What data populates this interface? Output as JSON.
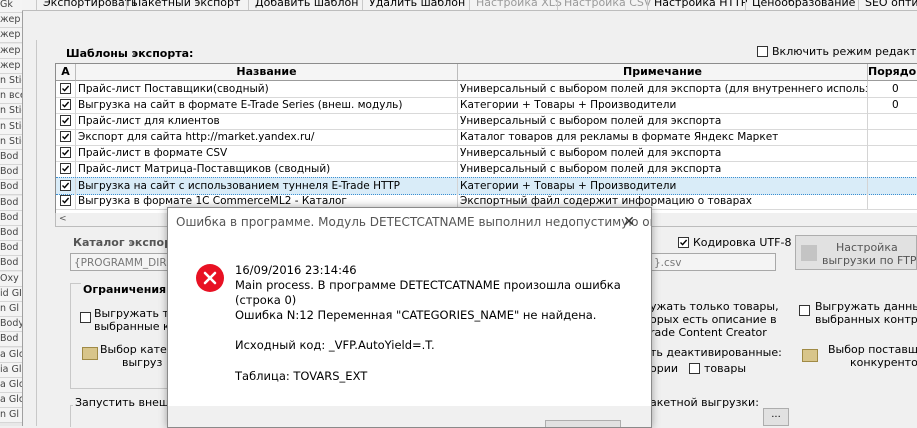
{
  "left_strip": {
    "items": [
      "Gk",
      "жер I",
      "жер I",
      "жер I",
      "жер I",
      "n Stig",
      "n все",
      "n Stig",
      "n Stig",
      "n Stig",
      "Bod",
      "Bod",
      "Bod",
      "Bod",
      "Bod",
      "Bod",
      "Bod",
      "Bod",
      "Oxy",
      "id GI",
      "n Gl",
      "Body",
      "Bod",
      "a Glo",
      "ia Gl",
      "a Glo",
      "a Glo",
      "n Gl"
    ]
  },
  "toolbar": {
    "items": [
      {
        "label": "Экспортировать",
        "disabled": false
      },
      {
        "label": "Пакетный экспорт",
        "disabled": false
      },
      {
        "label": "Добавить шаблон",
        "disabled": false
      },
      {
        "label": "Удалить шаблон",
        "disabled": false
      },
      {
        "label": "Настройка XLS",
        "disabled": true
      },
      {
        "label": "Настройка CSV",
        "disabled": true
      },
      {
        "label": "Настройка HTTP",
        "disabled": false
      },
      {
        "label": "Ценообразование",
        "disabled": false
      },
      {
        "label": "SEO оптими",
        "disabled": false
      }
    ]
  },
  "templates": {
    "title": "Шаблоны экспорта:",
    "editor_mode_label": "Включить режим редактиро",
    "columns": {
      "active": "А",
      "name": "Название",
      "note": "Примечание",
      "order": "Порядо"
    },
    "rows": [
      {
        "checked": true,
        "name": "Прайс-лист Поставщики(сводный)",
        "note": "Универсальный с выбором полей для экспорта (для внутреннего использования",
        "order": "0",
        "selected": false
      },
      {
        "checked": true,
        "name": "Выгрузка на сайт в формате E-Trade Series (внеш. модуль)",
        "note": "Категории + Товары + Производители",
        "order": "0",
        "selected": false
      },
      {
        "checked": true,
        "name": "Прайс-лист для клиентов",
        "note": "Универсальный с выбором полей для экспорта",
        "order": "",
        "selected": false
      },
      {
        "checked": true,
        "name": "Экспорт для сайта http://market.yandex.ru/",
        "note": "Каталог товаров для рекламы в формате Яндекс Маркет",
        "order": "",
        "selected": false
      },
      {
        "checked": true,
        "name": "Прайс-лист в формате CSV",
        "note": "Универсальный с выбором полей для экспорта",
        "order": "",
        "selected": false
      },
      {
        "checked": true,
        "name": "Прайс-лист Матрица-Поставщиков (сводный)",
        "note": "Универсальный с выбором полей для экспорта",
        "order": "",
        "selected": false
      },
      {
        "checked": true,
        "name": "Выгрузка на сайт с использованием туннеля E-Trade HTTP",
        "note": "Категории + Товары + Производители",
        "order": "",
        "selected": true
      },
      {
        "checked": true,
        "name": "Выгрузка в формате  1С CommerceML2 - Каталог",
        "note": "Экспортный файл содержит информацию о товарах",
        "order": "",
        "selected": false
      }
    ]
  },
  "export_settings": {
    "catalog_label": "Каталог экспорт",
    "catalog_value": "{PROGRAMM_DIR}\\",
    "file_suffix": "}.csv",
    "utf8_label": "Кодировка UTF-8",
    "ftp_button": [
      "Настройка",
      "выгрузки по FTP"
    ]
  },
  "restrictions": {
    "title": "Ограничения",
    "upload_cat_lines": [
      "Выгружать тол",
      "выбранные ка"
    ],
    "cat_button_lines": [
      "Выбор катего",
      "выгруз"
    ],
    "only_goods_lines": [
      "ужать только товары,",
      "орых есть описание в",
      "rade Content Creator"
    ],
    "suppliers_data_lines": [
      "Выгружать данные",
      "выбранных контраг"
    ],
    "supplier_button_lines": [
      "Выбор поставщ",
      "конкурентов"
    ],
    "deactivated_label": "ть деактивированные:",
    "categories_partial": "ории",
    "goods_label": "товары"
  },
  "external": {
    "run_label": "Запустить внешн",
    "batch_label": "акетной выгрузки:",
    "browse_label": "..."
  },
  "dialog": {
    "title": "Ошибка в программе. Модуль DETECTCATNAME выполнил недопустимую оп...",
    "close_glyph": "✕",
    "lines": [
      "16/09/2016 23:14:46",
      "Main process. В программе DETECTCATNAME произошла ошибка",
      "(строка 0)",
      "Ошибка N:12 Переменная \"CATEGORIES_NAME\" не найдена.",
      "Исходный код: _VFP.AutoYield=.T.",
      "Таблица: TOVARS_EXT"
    ],
    "icon": "error-icon",
    "accent_color": "#e81123"
  }
}
